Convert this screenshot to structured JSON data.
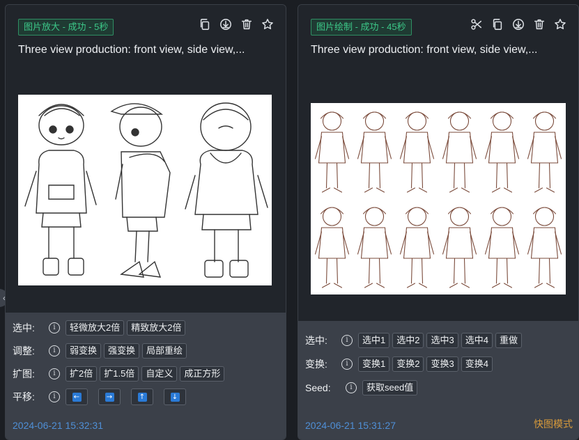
{
  "left_card": {
    "status_tag": "图片放大 - 成功 - 5秒",
    "prompt": "Three view production: front view, side view,...",
    "image_alt": "three-view line drawing of a boy in a cap and hoodie",
    "rows": [
      {
        "label": "选中:",
        "buttons": [
          "轻微放大2倍",
          "精致放大2倍"
        ]
      },
      {
        "label": "调整:",
        "buttons": [
          "弱变换",
          "强变换",
          "局部重绘"
        ]
      },
      {
        "label": "扩图:",
        "buttons": [
          "扩2倍",
          "扩1.5倍",
          "自定义",
          "成正方形"
        ]
      },
      {
        "label": "平移:",
        "arrows": [
          "←",
          "→",
          "↑",
          "↓"
        ]
      }
    ],
    "timestamp": "2024-06-21 15:32:31"
  },
  "right_card": {
    "status_tag": "图片绘制 - 成功 - 45秒",
    "prompt": "Three view production: front view, side view,...",
    "image_alt": "grid of twelve character sketches",
    "rows": [
      {
        "label": "选中:",
        "buttons": [
          "选中1",
          "选中2",
          "选中3",
          "选中4",
          "重做"
        ]
      },
      {
        "label": "变换:",
        "buttons": [
          "变换1",
          "变换2",
          "变换3",
          "变换4"
        ]
      },
      {
        "label": "Seed:",
        "buttons": [
          "获取seed值"
        ]
      }
    ],
    "timestamp": "2024-06-21 15:31:27",
    "quick_mode": "快图模式"
  },
  "icons": {
    "left_tools": [
      "copy-icon",
      "download-icon",
      "trash-icon",
      "star-icon"
    ],
    "right_tools": [
      "scissors-icon",
      "copy-icon",
      "download-icon",
      "trash-icon",
      "star-icon"
    ],
    "collapse": "chevron-left-icon",
    "info": "info-icon"
  },
  "colors": {
    "success_tag": "#3cc788",
    "timestamp": "#4f8fd6",
    "quick_mode": "#d79a3b",
    "arrow_key": "#2a7ad6"
  }
}
